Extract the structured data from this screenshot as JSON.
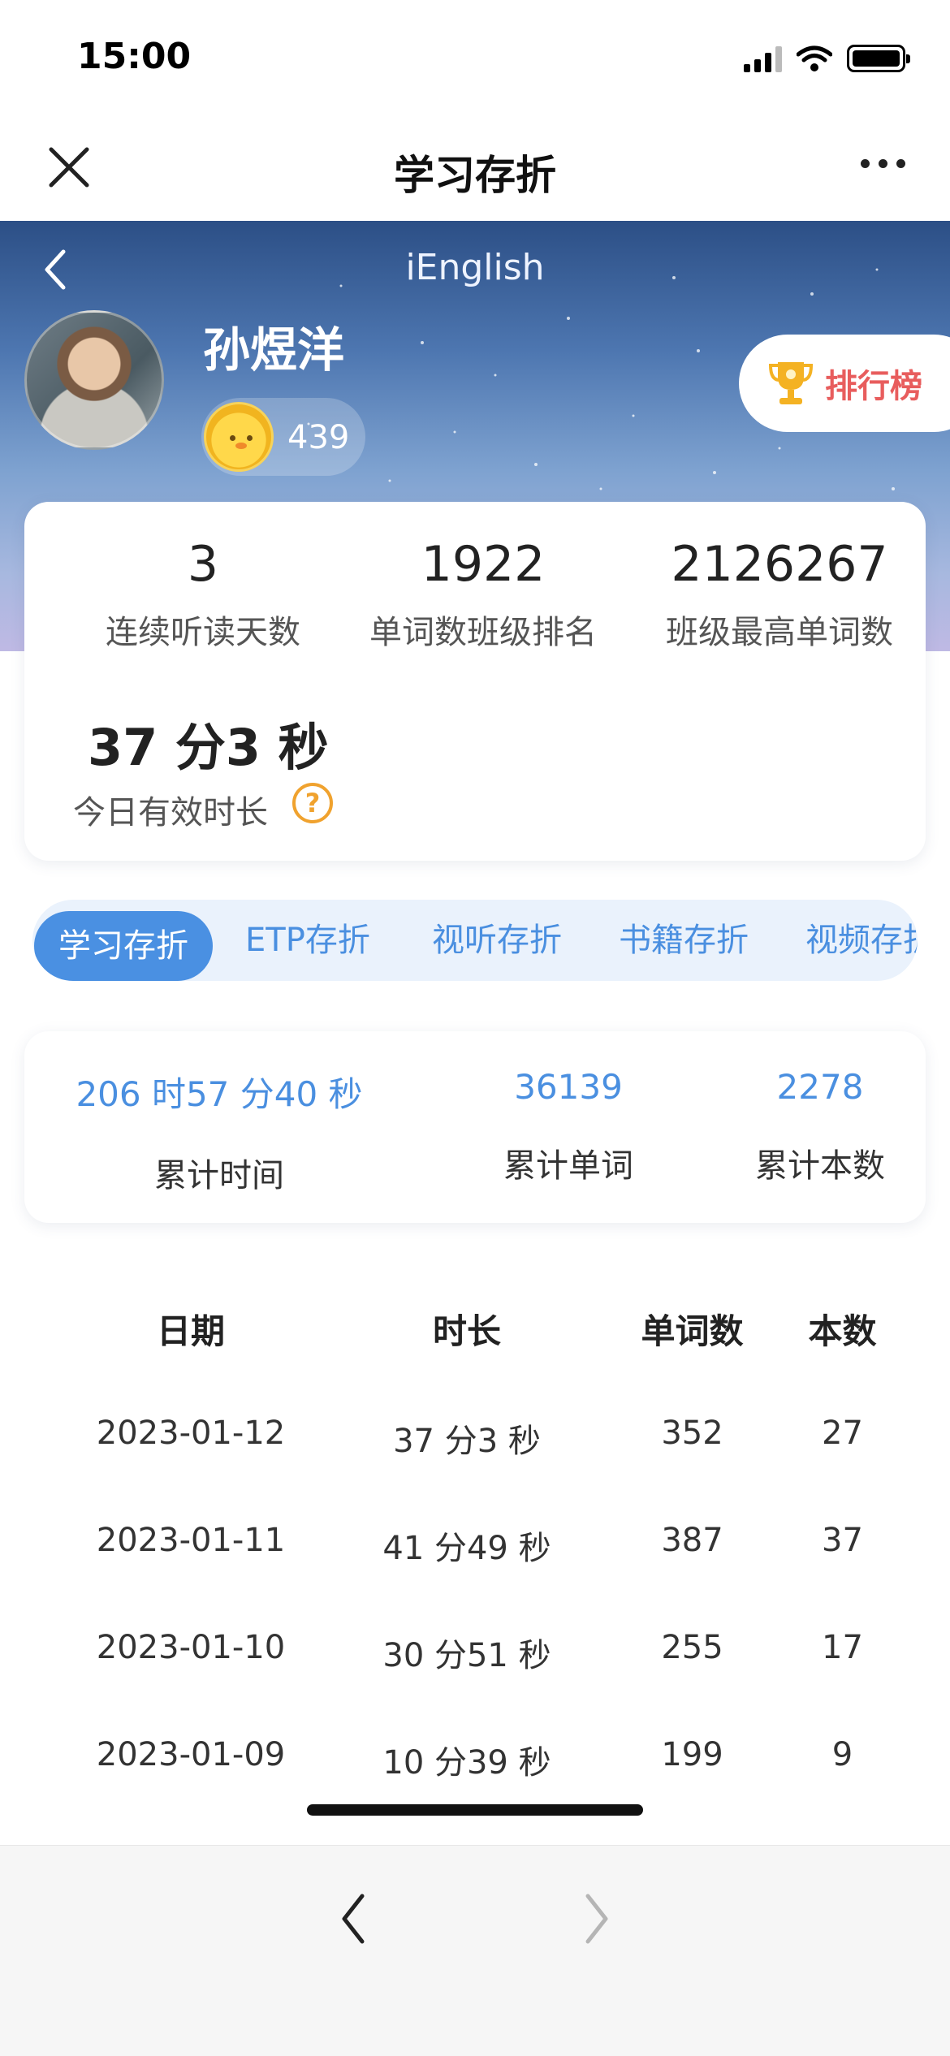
{
  "status_bar": {
    "time": "15:00"
  },
  "title_bar": {
    "title": "学习存折"
  },
  "hero": {
    "brand": "iEnglish",
    "user_name": "孙煜洋",
    "coins": "439",
    "rank_label": "排行榜"
  },
  "stats": [
    {
      "value": "3",
      "label": "连续听读天数"
    },
    {
      "value": "1922",
      "label": "单词数班级排名"
    },
    {
      "value": "2126267",
      "label": "班级最高单词数"
    }
  ],
  "today": {
    "value": "37 分3 秒",
    "label": "今日有效时长",
    "help": "?"
  },
  "tabs": [
    {
      "label": "学习存折",
      "active": true
    },
    {
      "label": "ETP存折"
    },
    {
      "label": "视听存折"
    },
    {
      "label": "书籍存折"
    },
    {
      "label": "视频存折"
    }
  ],
  "summary": [
    {
      "value": "206 时57 分40 秒",
      "label": "累计时间"
    },
    {
      "value": "36139",
      "label": "累计单词"
    },
    {
      "value": "2278",
      "label": "累计本数"
    }
  ],
  "table": {
    "headers": [
      "日期",
      "时长",
      "单词数",
      "本数"
    ],
    "rows": [
      [
        "2023-01-12",
        "37 分3 秒",
        "352",
        "27"
      ],
      [
        "2023-01-11",
        "41 分49 秒",
        "387",
        "37"
      ],
      [
        "2023-01-10",
        "30 分51 秒",
        "255",
        "17"
      ],
      [
        "2023-01-09",
        "10 分39 秒",
        "199",
        "9"
      ]
    ]
  },
  "colors": {
    "accent": "#4a90e2",
    "rank_text": "#e85d5d",
    "help_icon": "#f0a22e",
    "coin": "#f1b41f"
  },
  "icons": [
    "close-icon",
    "more-icon",
    "back-icon",
    "coin-icon",
    "trophy-icon",
    "help-icon",
    "nav-back-icon",
    "nav-forward-icon"
  ]
}
